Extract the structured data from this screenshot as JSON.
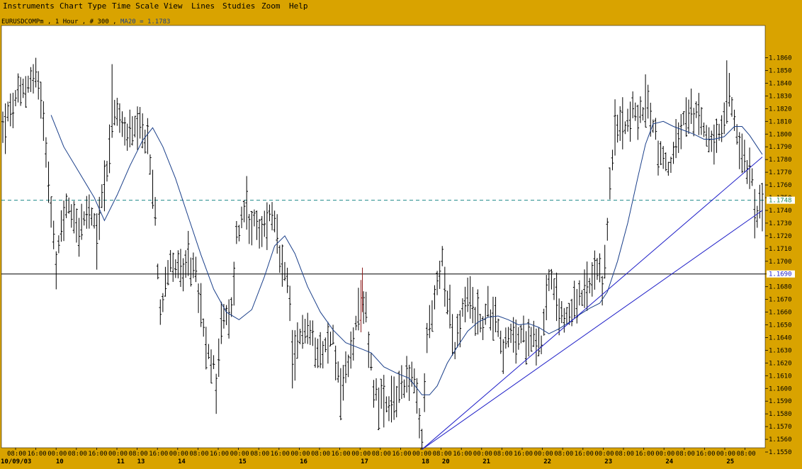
{
  "menu": {
    "items": [
      "Instruments",
      "Chart Type",
      "Time Scale",
      "View",
      "Lines",
      "Studies",
      "Zoom",
      "Help"
    ]
  },
  "info_bar": {
    "symbol": "EURUSDCOMPm",
    "interval": "1 Hour",
    "bars": "# 300",
    "study": "MA20 = 1.1783"
  },
  "colors": {
    "background": "#d9a300",
    "plot_bg": "#ffffff",
    "bars": "#000000",
    "ma": "#1a3f8a",
    "trend": "#2020c8",
    "dashed": "#1e8a8a",
    "hline": "#000000",
    "red_bar": "#8b1a1a"
  },
  "chart_data": {
    "type": "ohlc",
    "title": "",
    "ylim": [
      1.1545,
      1.1875
    ],
    "y_ticks": [
      1.186,
      1.185,
      1.184,
      1.183,
      1.182,
      1.181,
      1.18,
      1.179,
      1.178,
      1.177,
      1.176,
      1.175,
      1.174,
      1.173,
      1.172,
      1.171,
      1.17,
      1.169,
      1.168,
      1.167,
      1.166,
      1.165,
      1.164,
      1.163,
      1.162,
      1.161,
      1.16,
      1.159,
      1.158,
      1.157,
      1.156,
      1.155
    ],
    "y_tick_labels": [
      "1.1860",
      "1.1850",
      "1.1840",
      "1.1830",
      "1.1820",
      "1.1810",
      "1.1800",
      "1.1790",
      "1.1780",
      "1.1770",
      "1.1760",
      "1.1750",
      "1.1740",
      "1.1730",
      "1.1720",
      "1.1710",
      "1.1700",
      "1.1690",
      "1.1680",
      "1.1670",
      "1.1660",
      "1.1650",
      "1.1640",
      "1.1630",
      "1.1620",
      "1.1610",
      "1.1600",
      "1.1590",
      "1.1580",
      "1.1570",
      "1.1560",
      "1.1550"
    ],
    "bar_count": 300,
    "x_time_labels": [
      "08:00",
      "16:00",
      "00:00",
      "08:00",
      "16:00",
      "00:00",
      "08:00",
      "16:00",
      "00:00",
      "08:00",
      "16:00",
      "00:00",
      "08:00",
      "16:00",
      "00:00",
      "08:00",
      "16:00",
      "00:00",
      "08:00",
      "16:00",
      "00:00",
      "08:00",
      "16:00",
      "00:00",
      "08:00",
      "16:00",
      "00:00",
      "08:00",
      "16:00",
      "00:00",
      "08:00",
      "16:00",
      "00:00",
      "08:00",
      "16:00",
      "00:00",
      "08:00",
      "16:00",
      "00:00",
      "08:00",
      "16:00",
      "00:00",
      "08:00",
      "16:00",
      "00:00",
      "08:00",
      "16:00",
      "00:00",
      "08:00",
      "16:00",
      "00:00",
      "08:00",
      "16:00",
      "00:00",
      "08:00",
      "16:00",
      "00:00",
      "08:00",
      "16:00",
      "00:00",
      "08:00",
      "16:00",
      "00:00"
    ],
    "x_date_labels": [
      {
        "bar": 0,
        "text": "10/09/03"
      },
      {
        "bar": 22,
        "text": "10"
      },
      {
        "bar": 46,
        "text": "11"
      },
      {
        "bar": 54,
        "text": "13"
      },
      {
        "bar": 70,
        "text": "14"
      },
      {
        "bar": 94,
        "text": "15"
      },
      {
        "bar": 118,
        "text": "16"
      },
      {
        "bar": 142,
        "text": "17"
      },
      {
        "bar": 166,
        "text": "18"
      },
      {
        "bar": 174,
        "text": "20"
      },
      {
        "bar": 190,
        "text": "21"
      },
      {
        "bar": 214,
        "text": "22"
      },
      {
        "bar": 238,
        "text": "23"
      },
      {
        "bar": 262,
        "text": "24"
      },
      {
        "bar": 286,
        "text": "25"
      }
    ],
    "anchors": [
      [
        0,
        1.1805
      ],
      [
        5,
        1.1825
      ],
      [
        10,
        1.184
      ],
      [
        13,
        1.1848
      ],
      [
        16,
        1.1815
      ],
      [
        19,
        1.1745
      ],
      [
        21,
        1.169
      ],
      [
        23,
        1.173
      ],
      [
        26,
        1.1745
      ],
      [
        30,
        1.1725
      ],
      [
        34,
        1.1738
      ],
      [
        37,
        1.172
      ],
      [
        39,
        1.175
      ],
      [
        42,
        1.179
      ],
      [
        44,
        1.182
      ],
      [
        47,
        1.1805
      ],
      [
        50,
        1.18
      ],
      [
        54,
        1.18
      ],
      [
        57,
        1.1795
      ],
      [
        60,
        1.1735
      ],
      [
        62,
        1.166
      ],
      [
        64,
        1.169
      ],
      [
        67,
        1.17
      ],
      [
        71,
        1.169
      ],
      [
        75,
        1.17
      ],
      [
        78,
        1.166
      ],
      [
        80,
        1.163
      ],
      [
        84,
        1.161
      ],
      [
        86,
        1.165
      ],
      [
        90,
        1.166
      ],
      [
        92,
        1.172
      ],
      [
        95,
        1.174
      ],
      [
        98,
        1.173
      ],
      [
        101,
        1.172
      ],
      [
        106,
        1.174
      ],
      [
        109,
        1.17
      ],
      [
        112,
        1.168
      ],
      [
        115,
        1.162
      ],
      [
        118,
        1.165
      ],
      [
        122,
        1.164
      ],
      [
        126,
        1.163
      ],
      [
        130,
        1.164
      ],
      [
        133,
        1.16
      ],
      [
        135,
        1.161
      ],
      [
        138,
        1.164
      ],
      [
        141,
        1.166
      ],
      [
        143,
        1.166
      ],
      [
        146,
        1.16
      ],
      [
        149,
        1.159
      ],
      [
        152,
        1.158
      ],
      [
        156,
        1.16
      ],
      [
        159,
        1.161
      ],
      [
        162,
        1.1605
      ],
      [
        164,
        1.157
      ],
      [
        165,
        1.1555
      ],
      [
        167,
        1.164
      ],
      [
        170,
        1.167
      ],
      [
        173,
        1.17
      ],
      [
        175,
        1.1675
      ],
      [
        178,
        1.163
      ],
      [
        181,
        1.166
      ],
      [
        184,
        1.167
      ],
      [
        188,
        1.165
      ],
      [
        191,
        1.166
      ],
      [
        194,
        1.166
      ],
      [
        197,
        1.163
      ],
      [
        200,
        1.164
      ],
      [
        203,
        1.164
      ],
      [
        206,
        1.164
      ],
      [
        209,
        1.1645
      ],
      [
        212,
        1.1635
      ],
      [
        215,
        1.169
      ],
      [
        218,
        1.1665
      ],
      [
        221,
        1.1655
      ],
      [
        224,
        1.1665
      ],
      [
        228,
        1.167
      ],
      [
        231,
        1.168
      ],
      [
        234,
        1.169
      ],
      [
        236,
        1.168
      ],
      [
        237,
        1.17
      ],
      [
        239,
        1.176
      ],
      [
        241,
        1.18
      ],
      [
        244,
        1.181
      ],
      [
        248,
        1.1815
      ],
      [
        251,
        1.1815
      ],
      [
        254,
        1.182
      ],
      [
        256,
        1.181
      ],
      [
        258,
        1.179
      ],
      [
        260,
        1.178
      ],
      [
        263,
        1.1775
      ],
      [
        265,
        1.179
      ],
      [
        268,
        1.181
      ],
      [
        272,
        1.1815
      ],
      [
        275,
        1.181
      ],
      [
        278,
        1.18
      ],
      [
        281,
        1.179
      ],
      [
        284,
        1.181
      ],
      [
        286,
        1.183
      ],
      [
        288,
        1.181
      ],
      [
        290,
        1.179
      ],
      [
        292,
        1.178
      ],
      [
        295,
        1.177
      ],
      [
        297,
        1.174
      ],
      [
        299,
        1.1745
      ]
    ],
    "spikes": [
      {
        "bar": 13,
        "high": 1.186
      },
      {
        "bar": 43,
        "high": 1.1855
      },
      {
        "bar": 62,
        "low": 1.165
      },
      {
        "bar": 84,
        "low": 1.158
      },
      {
        "bar": 96,
        "high": 1.1767
      },
      {
        "bar": 114,
        "low": 1.16
      },
      {
        "bar": 133,
        "low": 1.1575
      },
      {
        "bar": 165,
        "low": 1.1552
      },
      {
        "bar": 173,
        "high": 1.1712
      },
      {
        "bar": 210,
        "low": 1.1618
      },
      {
        "bar": 253,
        "high": 1.1847
      },
      {
        "bar": 285,
        "high": 1.1858
      },
      {
        "bar": 296,
        "low": 1.1718
      }
    ],
    "ma20": {
      "name": "MA20",
      "last_value": 1.1783,
      "points": [
        [
          19,
          1.1815
        ],
        [
          24,
          1.179
        ],
        [
          30,
          1.177
        ],
        [
          36,
          1.175
        ],
        [
          40,
          1.1732
        ],
        [
          45,
          1.1752
        ],
        [
          50,
          1.1775
        ],
        [
          55,
          1.1795
        ],
        [
          59,
          1.1805
        ],
        [
          63,
          1.179
        ],
        [
          68,
          1.1765
        ],
        [
          73,
          1.1735
        ],
        [
          78,
          1.1705
        ],
        [
          83,
          1.1678
        ],
        [
          88,
          1.166
        ],
        [
          93,
          1.1654
        ],
        [
          98,
          1.1662
        ],
        [
          103,
          1.1688
        ],
        [
          107,
          1.1712
        ],
        [
          111,
          1.172
        ],
        [
          115,
          1.1706
        ],
        [
          120,
          1.168
        ],
        [
          125,
          1.166
        ],
        [
          130,
          1.1646
        ],
        [
          135,
          1.1636
        ],
        [
          140,
          1.1632
        ],
        [
          145,
          1.1628
        ],
        [
          150,
          1.1617
        ],
        [
          155,
          1.1612
        ],
        [
          160,
          1.1608
        ],
        [
          165,
          1.1595
        ],
        [
          168,
          1.1595
        ],
        [
          171,
          1.1602
        ],
        [
          175,
          1.162
        ],
        [
          179,
          1.1633
        ],
        [
          183,
          1.1645
        ],
        [
          187,
          1.1652
        ],
        [
          191,
          1.1656
        ],
        [
          195,
          1.1657
        ],
        [
          199,
          1.1654
        ],
        [
          203,
          1.165
        ],
        [
          207,
          1.1651
        ],
        [
          211,
          1.1648
        ],
        [
          215,
          1.1643
        ],
        [
          219,
          1.1647
        ],
        [
          223,
          1.1652
        ],
        [
          227,
          1.1658
        ],
        [
          231,
          1.1663
        ],
        [
          235,
          1.1667
        ],
        [
          238,
          1.1676
        ],
        [
          242,
          1.17
        ],
        [
          246,
          1.173
        ],
        [
          250,
          1.1766
        ],
        [
          253,
          1.1792
        ],
        [
          256,
          1.1808
        ],
        [
          260,
          1.181
        ],
        [
          264,
          1.1806
        ],
        [
          268,
          1.1803
        ],
        [
          272,
          1.18
        ],
        [
          276,
          1.1796
        ],
        [
          280,
          1.1796
        ],
        [
          284,
          1.1798
        ],
        [
          288,
          1.1806
        ],
        [
          291,
          1.1806
        ],
        [
          294,
          1.1799
        ],
        [
          297,
          1.179
        ],
        [
          299,
          1.1784
        ]
      ]
    },
    "horizontal_lines": [
      {
        "value": 1.1748,
        "label": "1.1748",
        "style": "dashed"
      },
      {
        "value": 1.169,
        "label": "1.1690",
        "style": "solid"
      }
    ],
    "trend_lines": [
      {
        "from": [
          165,
          1.1552
        ],
        "to": [
          299,
          1.1782
        ]
      },
      {
        "from": [
          165,
          1.1552
        ],
        "to": [
          299,
          1.174
        ]
      }
    ],
    "red_bar": {
      "bar": 141
    }
  }
}
